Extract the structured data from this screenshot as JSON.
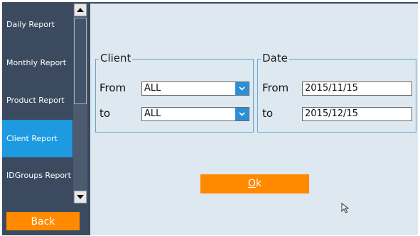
{
  "sidebar": {
    "items": [
      {
        "label": "Daily Report"
      },
      {
        "label": "Monthly Report"
      },
      {
        "label": "Product Report"
      },
      {
        "label": "Client Report"
      },
      {
        "label": "IDGroups Report"
      }
    ],
    "active_item": "Client Report",
    "back_label": "Back"
  },
  "client": {
    "title": "Client",
    "from_label": "From",
    "to_label": "to",
    "from_value": "ALL",
    "to_value": "ALL"
  },
  "date": {
    "title": "Date",
    "from_label": "From",
    "to_label": "to",
    "from_value": "2015/11/15",
    "to_value": "2015/12/15"
  },
  "ok_button": {
    "mnemonic": "O",
    "rest": "k"
  },
  "colors": {
    "accent_orange": "#ff8a00",
    "active_blue": "#1e9ae0",
    "sidebar_bg": "#3b4a5f",
    "main_bg": "#dde8f0"
  }
}
